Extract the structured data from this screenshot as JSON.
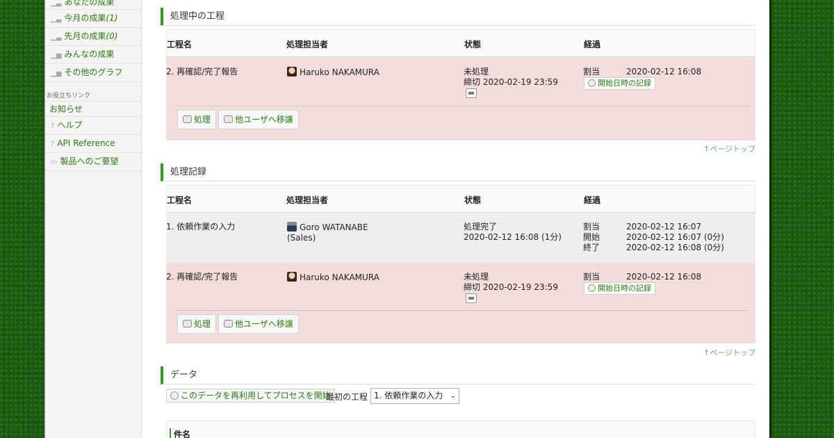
{
  "sidebar": {
    "items": [
      {
        "label": "あなたの成果",
        "count": ""
      },
      {
        "label": "今月の成果",
        "count": "(1)"
      },
      {
        "label": "先月の成果",
        "count": "(0)"
      },
      {
        "label": "みんなの成果",
        "count": ""
      },
      {
        "label": "その他のグラフ",
        "count": ""
      }
    ],
    "links_heading": "お役立ちリンク",
    "notice": "お知らせ",
    "help": "ヘルプ",
    "api": "API Reference",
    "feedback": "製品へのご要望"
  },
  "in_progress": {
    "title": "処理中の工程",
    "headers": {
      "step": "工程名",
      "assignee": "処理担当者",
      "status": "状態",
      "elapsed": "経過"
    },
    "row": {
      "step": "2. 再確認/完了報告",
      "assignee": "Haruko NAKAMURA",
      "status": "未処理",
      "deadline": "締切 2020-02-19 23:59",
      "assigned_label": "割当",
      "assigned_time": "2020-02-12 16:08",
      "record_start": "開始日時の記録"
    },
    "actions": {
      "process": "処理",
      "transfer": "他ユーザへ移譲"
    },
    "page_top": "↑ページトップ"
  },
  "history": {
    "title": "処理記録",
    "headers": {
      "step": "工程名",
      "assignee": "処理担当者",
      "status": "状態",
      "elapsed": "経過"
    },
    "row1": {
      "step": "1. 依頼作業の入力",
      "assignee": "Goro WATANABE",
      "assignee_dept": "(Sales)",
      "status": "処理完了",
      "status_time": "2020-02-12 16:08 (1分)",
      "assigned_label": "割当",
      "assigned_time": "2020-02-12 16:07",
      "start_label": "開始",
      "start_time": "2020-02-12 16:07 (0分)",
      "end_label": "終了",
      "end_time": "2020-02-12 16:08 (0分)"
    },
    "row2": {
      "step": "2. 再確認/完了報告",
      "assignee": "Haruko NAKAMURA",
      "status": "未処理",
      "deadline": "締切 2020-02-19 23:59",
      "assigned_label": "割当",
      "assigned_time": "2020-02-12 16:08",
      "record_start": "開始日時の記録"
    },
    "actions": {
      "process": "処理",
      "transfer": "他ユーザへ移譲"
    },
    "page_top": "↑ページトップ"
  },
  "data_section": {
    "title": "データ",
    "reuse_button": "このデータを再利用してプロセスを開始",
    "first_step_label": "最初の工程",
    "first_step_value": "1. 依頼作業の入力",
    "subject_label": "件名"
  }
}
